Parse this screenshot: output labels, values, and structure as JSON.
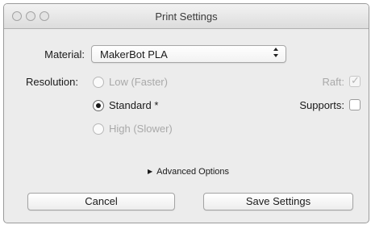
{
  "window": {
    "title": "Print Settings",
    "traffic_lights": [
      "close-icon",
      "minimize-icon",
      "zoom-icon"
    ]
  },
  "material": {
    "label": "Material:",
    "selected": "MakerBot PLA",
    "arrow_icon": "updown-arrows-icon"
  },
  "resolution": {
    "label": "Resolution:",
    "options": [
      {
        "label": "Low (Faster)",
        "selected": false,
        "enabled": false
      },
      {
        "label": "Standard *",
        "selected": true,
        "enabled": true
      },
      {
        "label": "High (Slower)",
        "selected": false,
        "enabled": false
      }
    ]
  },
  "raft": {
    "label": "Raft:",
    "checked": true,
    "enabled": false
  },
  "supports": {
    "label": "Supports:",
    "checked": false,
    "enabled": true
  },
  "advanced": {
    "label": "Advanced Options",
    "icon": "disclosure-triangle-icon"
  },
  "buttons": {
    "cancel": "Cancel",
    "save": "Save Settings"
  },
  "glyphs": {
    "updown": "⬍",
    "check": "✓",
    "triangle": "▶"
  }
}
